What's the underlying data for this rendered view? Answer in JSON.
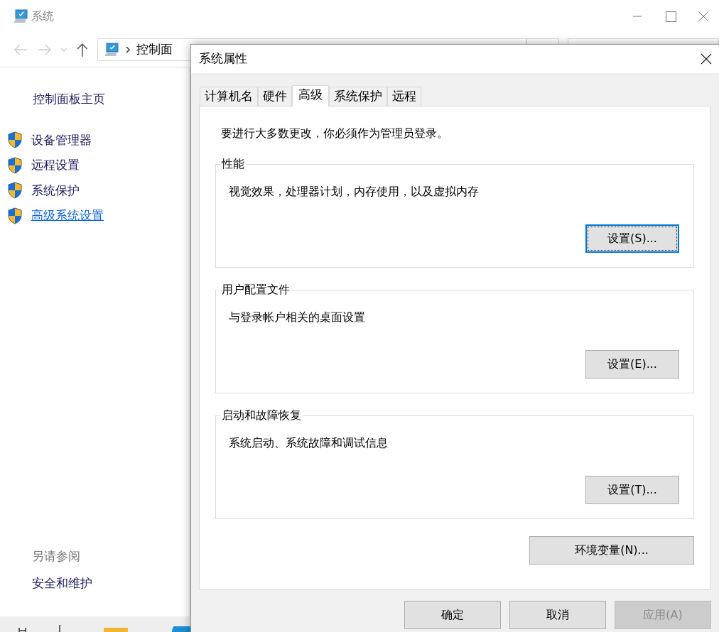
{
  "window": {
    "title": "系统",
    "address": "控制面"
  },
  "sidebar": {
    "home": "控制面板主页",
    "items": [
      {
        "label": "设备管理器",
        "hovered": false
      },
      {
        "label": "远程设置",
        "hovered": false
      },
      {
        "label": "系统保护",
        "hovered": false
      },
      {
        "label": "高级系统设置",
        "hovered": true
      }
    ],
    "see_also_title": "另请参阅",
    "see_also": [
      "安全和维护"
    ]
  },
  "dialog": {
    "title": "系统属性",
    "tabs": [
      {
        "label": "计算机名",
        "selected": false
      },
      {
        "label": "硬件",
        "selected": false
      },
      {
        "label": "高级",
        "selected": true
      },
      {
        "label": "系统保护",
        "selected": false
      },
      {
        "label": "远程",
        "selected": false
      }
    ],
    "notice": "要进行大多数更改，你必须作为管理员登录。",
    "groups": [
      {
        "title": "性能",
        "description": "视觉效果，处理器计划，内存使用，以及虚拟内存",
        "button": "设置(S)...",
        "focused": true
      },
      {
        "title": "用户配置文件",
        "description": "与登录帐户相关的桌面设置",
        "button": "设置(E)...",
        "focused": false
      },
      {
        "title": "启动和故障恢复",
        "description": "系统启动、系统故障和调试信息",
        "button": "设置(T)...",
        "focused": false
      }
    ],
    "env_button": "环境变量(N)...",
    "buttons": [
      {
        "label": "确定",
        "disabled": false
      },
      {
        "label": "取消",
        "disabled": false
      },
      {
        "label": "应用(A)",
        "disabled": true
      }
    ]
  }
}
